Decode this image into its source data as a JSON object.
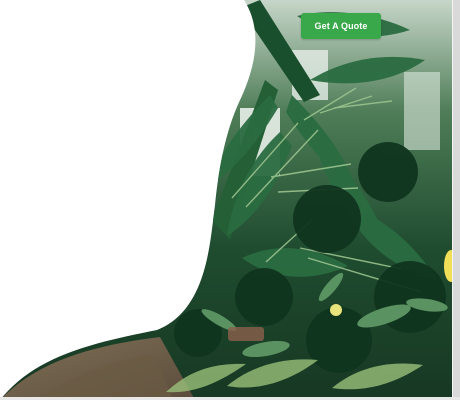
{
  "header": {
    "cta_label": "Get A Quote"
  },
  "theme": {
    "accent": "#39a84a",
    "foliage_dark": "#1d4d2d",
    "foliage_mid": "#2f6e3f",
    "foliage_light": "#6fa165",
    "ground": "#6c5c46",
    "background": "#ffffff"
  }
}
